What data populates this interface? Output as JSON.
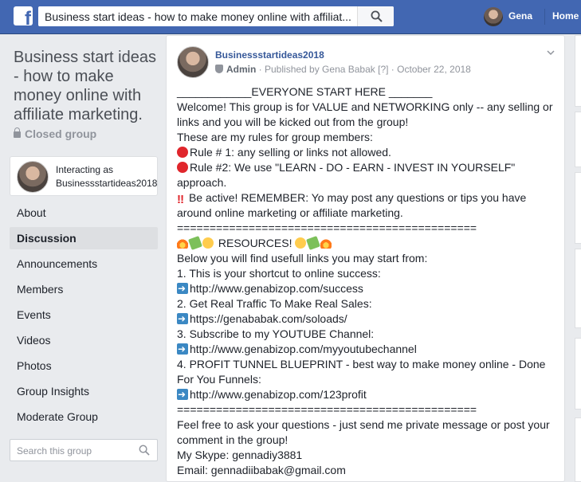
{
  "topbar": {
    "logo": "f",
    "search_value": "Business start ideas - how to make money online with affiliat...",
    "user_name": "Gena",
    "home_label": "Home"
  },
  "sidebar": {
    "group_title": "Business start ideas - how to make money online with affiliate marketing.",
    "privacy": "Closed group",
    "interacting_label": "Interacting as",
    "interacting_name": "Businessstartideas2018",
    "items": [
      {
        "label": "About"
      },
      {
        "label": "Discussion",
        "active": true
      },
      {
        "label": "Announcements"
      },
      {
        "label": "Members"
      },
      {
        "label": "Events"
      },
      {
        "label": "Videos"
      },
      {
        "label": "Photos"
      },
      {
        "label": "Group Insights"
      },
      {
        "label": "Moderate Group"
      }
    ],
    "search_placeholder": "Search this group"
  },
  "post": {
    "author": "Businessstartideas2018",
    "role": "Admin",
    "published_by": " · Published by Gena Babak [?] · October 22, 2018",
    "lines": [
      "____________EVERYONE START HERE _______",
      "Welcome! This group is for VALUE and NETWORKING only -- any selling or",
      "links and you will be kicked out from the group!",
      "These are my rules for group members:",
      "Rule # 1: any selling or links not allowed.",
      "Rule #2: We use \"LEARN - DO - EARN - INVEST IN YOURSELF\"",
      "approach.",
      " Be active! REMEMBER: Yo may post any questions or tips you have",
      "around online marketing or affiliate marketing.",
      "==============================================",
      " RESOURCES! ",
      "Below you will find usefull links you may start from:",
      "1. This is your shortcut to online success:",
      "http://www.genabizop.com/success",
      "2. Get Real Traffic To Make Real Sales:",
      "https://genababak.com/soloads/",
      "3. Subscribe to my YOUTUBE Channel:",
      "http://www.genabizop.com/myyoutubechannel",
      "4. PROFIT TUNNEL BLUEPRINT - best way to make money online - Done",
      "For You Funnels:",
      "http://www.genabizop.com/123profit",
      "==============================================",
      "Feel free to ask your questions - just send me private message or post your",
      "comment in the group!",
      "My Skype: gennadiy3881",
      "Email: gennadiibabak@gmail.com"
    ]
  },
  "colors": {
    "topbar": "#4267b2",
    "link": "#365899",
    "background": "#e9ebee"
  }
}
